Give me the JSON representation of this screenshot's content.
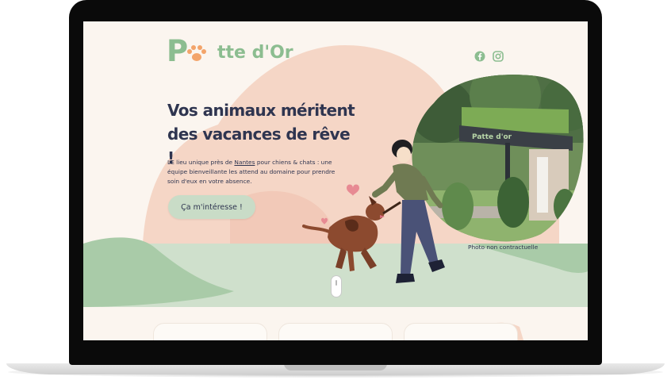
{
  "brand": {
    "logo_first": "P",
    "logo_rest": "tte d'Or",
    "colors": {
      "green": "#8cbd90",
      "peach": "#f5d6c6",
      "navy": "#2f3550",
      "cream": "#fbf5ef",
      "mint": "#cfe0cc"
    }
  },
  "header": {
    "social": [
      {
        "icon": "facebook-icon"
      },
      {
        "icon": "instagram-icon"
      }
    ]
  },
  "hero": {
    "headline": "Vos animaux méritent des vacances de rêve !",
    "intro_pre": "LE lieu unique près de ",
    "intro_link": "Nantes",
    "intro_post": " pour chiens & chats : une équipe bienveillante les attend au domaine pour prendre soin d'eux en votre absence.",
    "cta_label": "Ça m'intéresse !",
    "photo_caption": "Photo non contractuelle",
    "photo_sign": "Patte d'or"
  }
}
